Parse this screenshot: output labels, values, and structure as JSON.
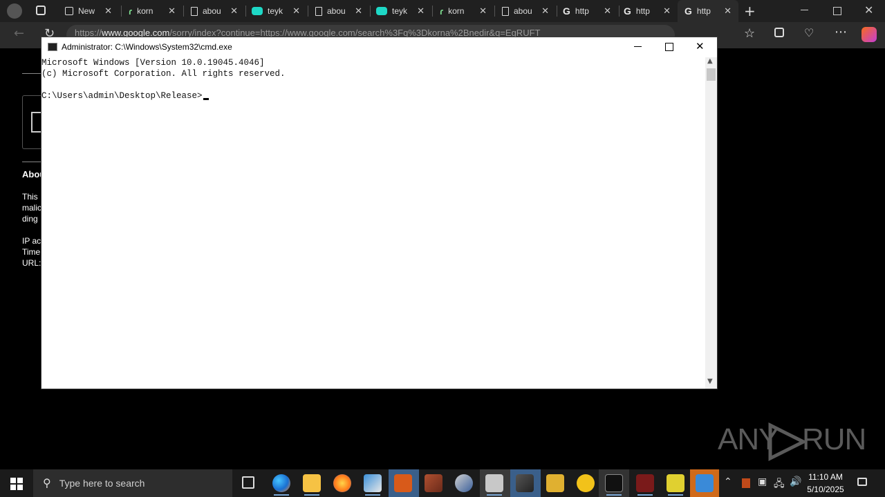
{
  "browser": {
    "tabs": [
      {
        "label": "New"
      },
      {
        "label": "korn"
      },
      {
        "label": "abou"
      },
      {
        "label": "teyk"
      },
      {
        "label": "abou"
      },
      {
        "label": "teyk"
      },
      {
        "label": "korn"
      },
      {
        "label": "abou"
      },
      {
        "label": "http"
      },
      {
        "label": "http"
      },
      {
        "label": "http"
      }
    ],
    "address": {
      "prefix": "https://",
      "host": "www.google.com",
      "path": "/sorry/index?continue=https://www.google.com/search%3Fq%3Dkorna%2Bnedir&q=EgRUFT"
    }
  },
  "page": {
    "about": "Abou",
    "line1": "This",
    "line2": "malic",
    "line3": "ding",
    "ip": "IP ac",
    "time": "Time",
    "url": "URL:"
  },
  "cmd": {
    "title": "Administrator: C:\\Windows\\System32\\cmd.exe",
    "line1": "Microsoft Windows [Version 10.0.19045.4046]",
    "line2": "(c) Microsoft Corporation. All rights reserved.",
    "prompt": "C:\\Users\\admin\\Desktop\\Release>"
  },
  "watermark": {
    "left": "ANY",
    "right": "RUN"
  },
  "taskbar": {
    "search_placeholder": "Type here to search",
    "time": "11:10 AM",
    "date": "5/10/2025"
  }
}
